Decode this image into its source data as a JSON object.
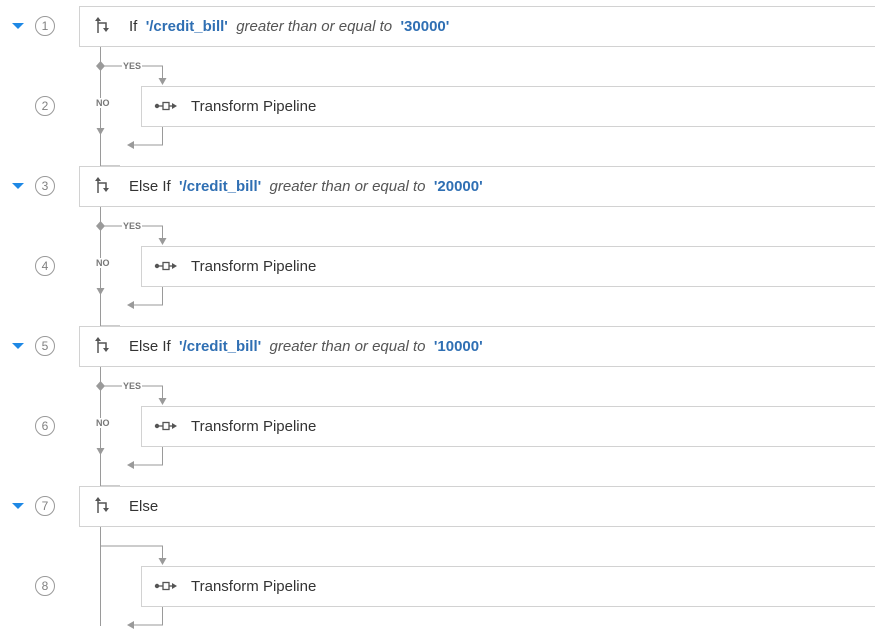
{
  "blocks": [
    {
      "step": "1",
      "keyword": "If",
      "path": "'/credit_bill'",
      "op": "greater than or equal to",
      "value": "'30000'"
    },
    {
      "step": "3",
      "keyword": "Else If",
      "path": "'/credit_bill'",
      "op": "greater than or equal to",
      "value": "'20000'"
    },
    {
      "step": "5",
      "keyword": "Else If",
      "path": "'/credit_bill'",
      "op": "greater than or equal to",
      "value": "'10000'"
    },
    {
      "step": "7",
      "keyword": "Else",
      "path": "",
      "op": "",
      "value": ""
    }
  ],
  "pipelines": [
    {
      "step": "2",
      "label": "Transform Pipeline"
    },
    {
      "step": "4",
      "label": "Transform Pipeline"
    },
    {
      "step": "6",
      "label": "Transform Pipeline"
    },
    {
      "step": "8",
      "label": "Transform Pipeline"
    }
  ],
  "branch_labels": {
    "yes": "YES",
    "no": "NO"
  },
  "icons": {
    "condition": "branch-icon",
    "pipeline": "pipeline-icon",
    "collapse": "caret-down-icon"
  },
  "colors": {
    "accent": "#1e88e5",
    "value_text": "#2f6fb3",
    "line": "#999999",
    "border": "#d2d2d2"
  }
}
